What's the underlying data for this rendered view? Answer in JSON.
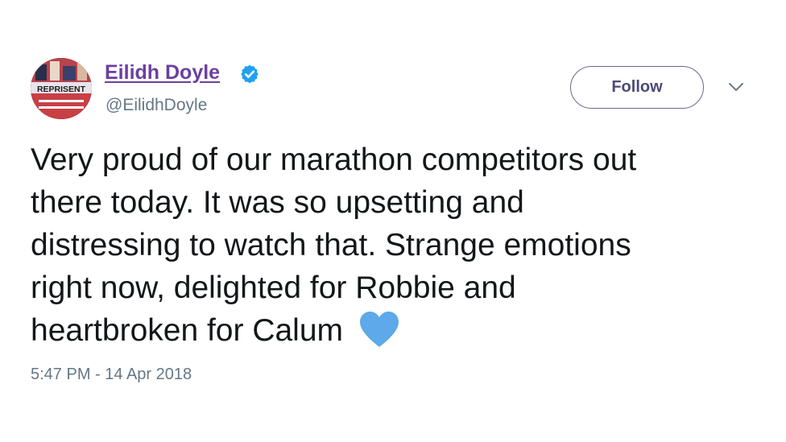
{
  "author": {
    "name": "Eilidh Doyle",
    "handle": "@EilidhDoyle",
    "verified": true,
    "avatar_text": "REPRISENT"
  },
  "follow_button": {
    "label": "Follow"
  },
  "tweet": {
    "lines": [
      "Very proud of our marathon competitors out",
      "there today. It was so upsetting and",
      "distressing to watch that. Strange emotions",
      "right now, delighted for Robbie and",
      "heartbroken for Calum"
    ],
    "emoji": "blue-heart-icon"
  },
  "timestamp": "5:47 PM - 14 Apr 2018",
  "colors": {
    "name": "#6b3fa0",
    "verified": "#1da1f2",
    "heart": "#5da9e9",
    "follow_border": "#6c6a8a",
    "meta_text": "#657786"
  }
}
